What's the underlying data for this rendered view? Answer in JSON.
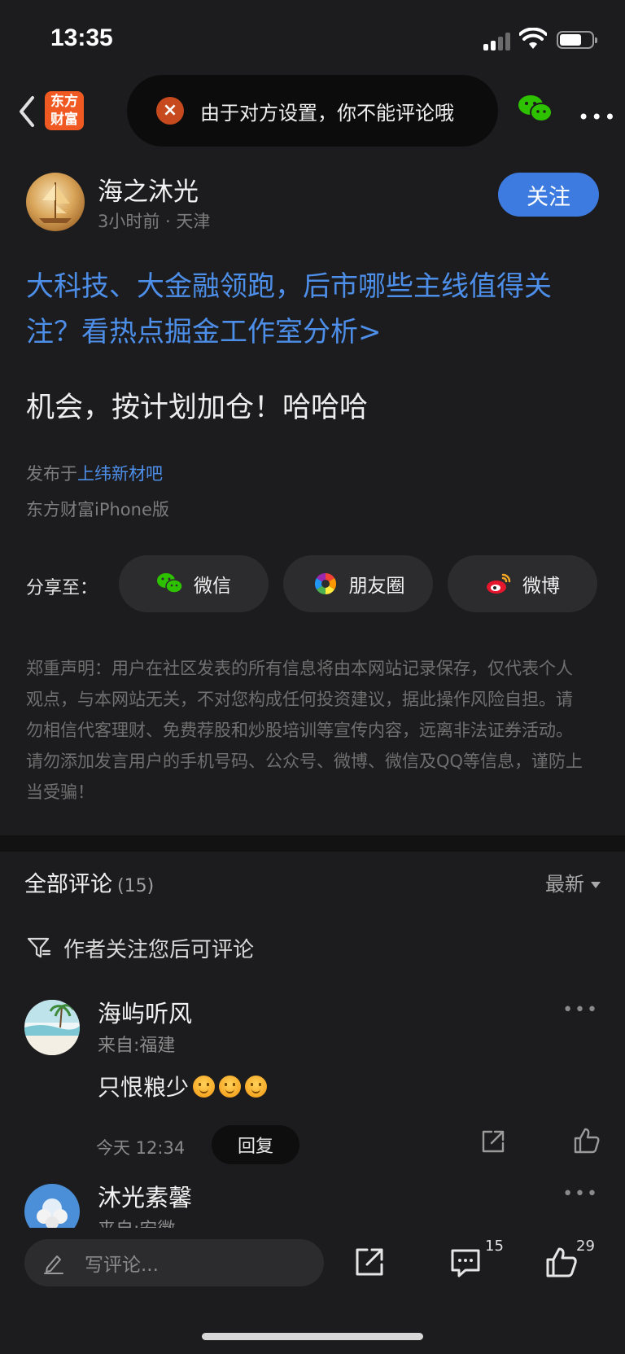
{
  "status": {
    "time": "13:35"
  },
  "nav": {
    "logo_line1": "东方",
    "logo_line2": "财富",
    "toast": "由于对方设置，你不能评论哦"
  },
  "post": {
    "author": "海之沐光",
    "meta": "3小时前 · 天津",
    "follow_label": "关注",
    "title": "大科技、大金融领跑，后市哪些主线值得关注？看热点掘金工作室分析>",
    "body": "机会，按计划加仓！哈哈哈",
    "posted_prefix": "发布于",
    "posted_bar": "上纬新材吧",
    "device": "东方财富iPhone版"
  },
  "share": {
    "label": "分享至：",
    "wechat": "微信",
    "moments": "朋友圈",
    "weibo": "微博"
  },
  "disclaimer": "郑重声明：用户在社区发表的所有信息将由本网站记录保存，仅代表个人观点，与本网站无关，不对您构成任何投资建议，据此操作风险自担。请勿相信代客理财、免费荐股和炒股培训等宣传内容，远离非法证券活动。请勿添加发言用户的手机号码、公众号、微博、微信及QQ等信息，谨防上当受骗！",
  "comments": {
    "title": "全部评论",
    "count": "(15)",
    "sort": "最新",
    "note": "作者关注您后可评论",
    "items": [
      {
        "name": "海屿听风",
        "from": "来自:福建",
        "text": "只恨粮少",
        "time": "今天 12:34",
        "reply": "回复"
      },
      {
        "name": "沐光素馨",
        "from": "来自:安徽"
      }
    ]
  },
  "bottom": {
    "placeholder": "写评论...",
    "comment_count": "15",
    "like_count": "29"
  },
  "colors": {
    "accent": "#3d7be0",
    "link": "#4d8ee8",
    "background": "#1c1c1e"
  }
}
